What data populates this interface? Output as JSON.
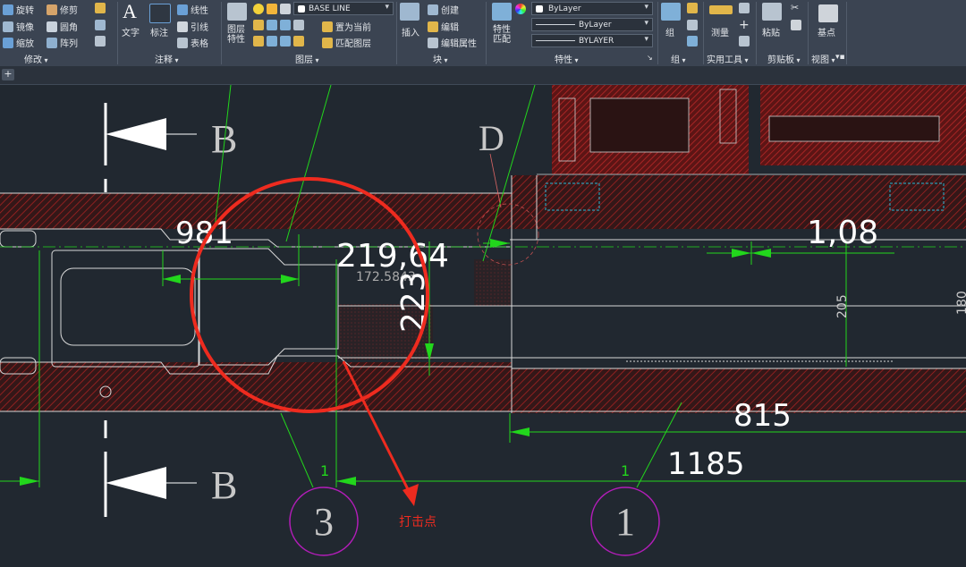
{
  "ribbon": {
    "modify": {
      "rotate": "旋转",
      "trim": "修剪",
      "mirror": "镜像",
      "fillet": "圆角",
      "scale": "缩放",
      "array": "阵列",
      "title": "修改"
    },
    "annotation": {
      "text": "文字",
      "dimension": "标注",
      "linear": "线性",
      "leader": "引线",
      "table": "表格",
      "title": "注释"
    },
    "layers": {
      "layer_properties": "图层特性",
      "current_layer": "BASE LINE",
      "set_current": "置为当前",
      "match_layer": "匹配图层",
      "title": "图层"
    },
    "block": {
      "insert": "插入",
      "create": "创建",
      "edit": "编辑",
      "edit_attributes": "编辑属性",
      "title": "块"
    },
    "properties": {
      "match": "特性匹配",
      "color": "ByLayer",
      "linetype": "ByLayer",
      "lineweight": "BYLAYER",
      "title": "特性"
    },
    "group": {
      "group": "组",
      "title": "组"
    },
    "utilities": {
      "measure": "测量",
      "title": "实用工具"
    },
    "clipboard": {
      "paste": "粘贴",
      "title": "剪贴板"
    },
    "view": {
      "base": "基点",
      "title": "视图"
    }
  },
  "tabbar": {
    "new_tab": "+"
  },
  "drawing": {
    "section_letter_top": "B",
    "section_letter_bottom": "B",
    "detail_letter": "D",
    "dims": {
      "d981": "981",
      "d219": "219,64",
      "d172": "172.5843",
      "d223": "223",
      "d1_08": "1,08",
      "d205": "205",
      "d180": "180",
      "d815": "815",
      "d1185": "1185",
      "d1a": "1",
      "d1b": "1"
    },
    "balloon_3": "3",
    "balloon_1": "1",
    "impact_label": "打击点"
  },
  "colors": {
    "background": "#212830",
    "ribbon": "#3b4452",
    "red": "#ee2b1f",
    "green": "#22d61c",
    "hatch": "#8a1c1c",
    "magenta": "#b21db8",
    "white": "#ffffff"
  }
}
